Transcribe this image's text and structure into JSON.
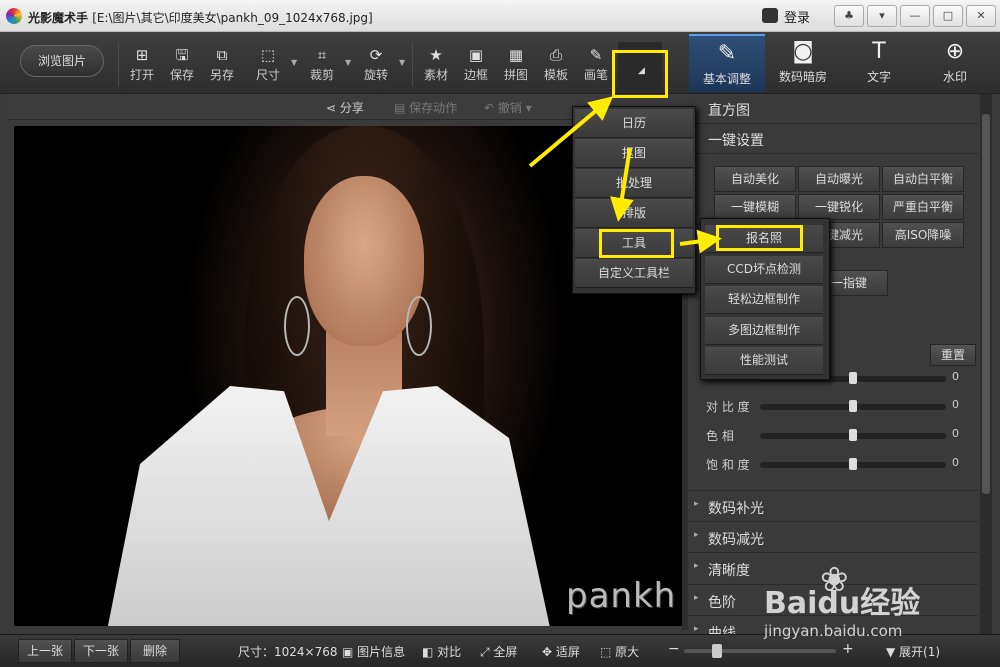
{
  "window": {
    "app_name": "光影魔术手",
    "file_path": "[E:\\图片\\其它\\印度美女\\pankh_09_1024x768.jpg]",
    "login_label": "登录",
    "buttons": [
      "♣",
      "▾",
      "—",
      "□",
      "✕"
    ]
  },
  "toolbar": {
    "browse_label": "浏览图片",
    "tools": [
      {
        "label": "打开",
        "icon": "⊞"
      },
      {
        "label": "保存",
        "icon": "🖫"
      },
      {
        "label": "另存",
        "icon": "⧉"
      },
      {
        "label": "尺寸",
        "icon": "⬚"
      },
      {
        "label": "裁剪",
        "icon": "⌗"
      },
      {
        "label": "旋转",
        "icon": "⟳"
      },
      {
        "label": "素材",
        "icon": "★"
      },
      {
        "label": "边框",
        "icon": "▣"
      },
      {
        "label": "拼图",
        "icon": "▦"
      },
      {
        "label": "模板",
        "icon": "⎙"
      },
      {
        "label": "画笔",
        "icon": "✎"
      }
    ],
    "more_icon": "◢"
  },
  "right_tabs": [
    {
      "label": "基本调整",
      "icon": "✎",
      "active": true
    },
    {
      "label": "数码暗房",
      "icon": "◙",
      "active": false
    },
    {
      "label": "文字",
      "icon": "T",
      "active": false
    },
    {
      "label": "水印",
      "icon": "⊕",
      "active": false
    }
  ],
  "subbar": {
    "share": "分享",
    "save_action": "保存动作",
    "undo": "撤销"
  },
  "canvas": {
    "watermark": "pankh"
  },
  "right_panel": {
    "histogram": "直方图",
    "onekey": "一键设置",
    "buttons": [
      "自动美化",
      "自动曝光",
      "自动白平衡",
      "一键模糊",
      "一键锐化",
      "严重白平衡",
      "",
      "一键减光",
      "高ISO降噪"
    ],
    "partial_button": "衡一指键",
    "reset_label": "重置",
    "sliders": [
      {
        "label": "",
        "value": "0"
      },
      {
        "label": "对 比 度",
        "value": "0"
      },
      {
        "label": "色    相",
        "value": "0"
      },
      {
        "label": "饱 和 度",
        "value": "0"
      }
    ],
    "sections": [
      "数码补光",
      "数码减光",
      "清晰度",
      "色阶",
      "曲线"
    ]
  },
  "menu": {
    "items": [
      "日历",
      "抠图",
      "批处理",
      "排版",
      "工具",
      "自定义工具栏"
    ]
  },
  "submenu": {
    "items": [
      "报名照",
      "CCD坏点检测",
      "轻松边框制作",
      "多图边框制作",
      "性能测试"
    ]
  },
  "bottom": {
    "prev": "上一张",
    "next": "下一张",
    "delete": "删除",
    "size": "尺寸：1024×768",
    "info": "图片信息",
    "compare": "对比",
    "fullscreen": "全屏",
    "fit": "适屏",
    "original": "原大",
    "expand": "展开(1)"
  },
  "overlay": {
    "baidu_brand": "Baidu经验",
    "baidu_site": "jingyan.baidu.com",
    "highlight_color": "#ffec00"
  }
}
